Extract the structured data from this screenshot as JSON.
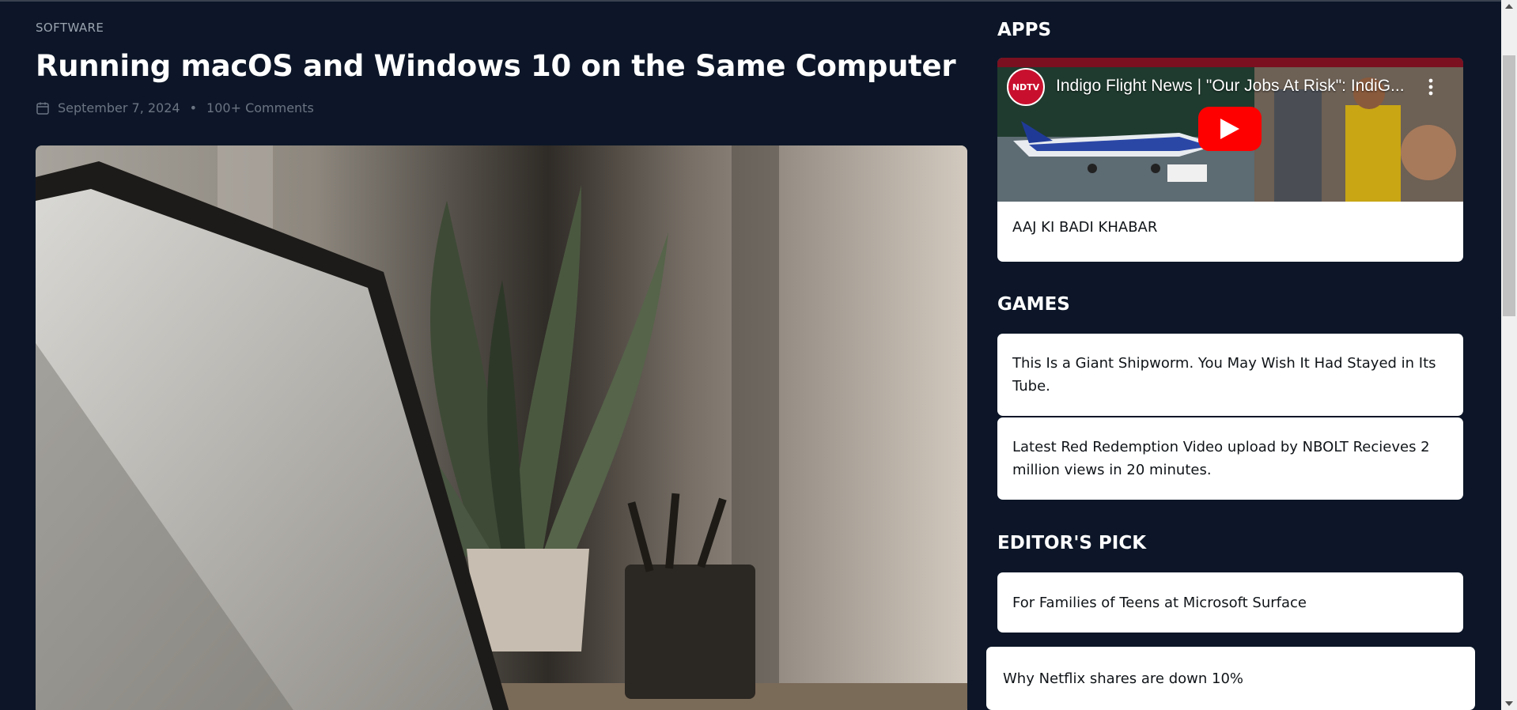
{
  "article": {
    "category": "SOFTWARE",
    "title": "Running macOS and Windows 10 on the Same Computer",
    "date": "September 7, 2024",
    "separator": "•",
    "comments": "100+ Comments",
    "date_icon": "calendar-icon"
  },
  "sidebar": {
    "apps": {
      "heading": "APPS",
      "video": {
        "channel_logo_text": "NDTV",
        "title": "Indigo Flight News | \"Our Jobs At Risk\": IndiG...",
        "caption": "AAJ KI BADI KHABAR"
      }
    },
    "games": {
      "heading": "GAMES",
      "items": [
        {
          "title": "This Is a Giant Shipworm. You May Wish It Had Stayed in Its Tube."
        },
        {
          "title": "Latest Red Redemption Video upload by NBOLT Recieves 2 million views in 20 minutes."
        }
      ]
    },
    "editors_pick": {
      "heading": "EDITOR'S PICK",
      "items": [
        {
          "title": "For Families of Teens at Microsoft Surface"
        },
        {
          "title": "Why Netflix shares are down 10%"
        }
      ]
    }
  },
  "colors": {
    "background": "#0c1628",
    "card": "#ffffff",
    "youtube_red": "#ff0000"
  }
}
